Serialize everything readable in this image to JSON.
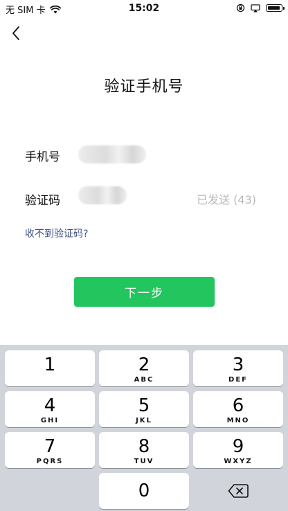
{
  "status_bar": {
    "carrier": "无 SIM 卡",
    "time": "15:02"
  },
  "page": {
    "title": "验证手机号"
  },
  "form": {
    "phone_label": "手机号",
    "code_label": "验证码",
    "resend_status": "已发送 (43)",
    "cant_receive_link": "收不到验证码?"
  },
  "actions": {
    "next_label": "下一步",
    "accent": "#22c55e"
  },
  "keypad": {
    "keys": [
      {
        "num": "1",
        "letters": ""
      },
      {
        "num": "2",
        "letters": "ABC"
      },
      {
        "num": "3",
        "letters": "DEF"
      },
      {
        "num": "4",
        "letters": "GHI"
      },
      {
        "num": "5",
        "letters": "JKL"
      },
      {
        "num": "6",
        "letters": "MNO"
      },
      {
        "num": "7",
        "letters": "PQRS"
      },
      {
        "num": "8",
        "letters": "TUV"
      },
      {
        "num": "9",
        "letters": "WXYZ"
      },
      {
        "num": "0",
        "letters": ""
      }
    ],
    "delete_icon": "backspace-icon"
  }
}
